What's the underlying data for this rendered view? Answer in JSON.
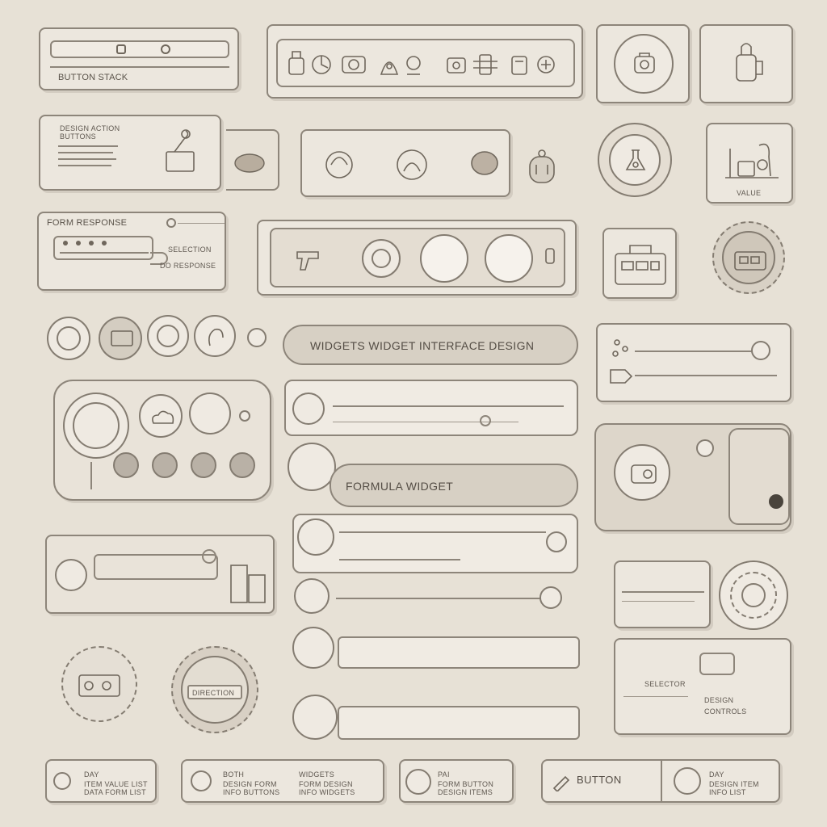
{
  "colors": {
    "background": "#e7e1d6",
    "panel": "#ece7de",
    "stroke": "#8d857a",
    "accent_dark": "#4a443c",
    "pill": "#d7d0c4"
  },
  "top_left_card": {
    "label": "BUTTON STACK"
  },
  "header_card": {
    "title": "DESIGN ACTION",
    "subtitle": "BUTTONS"
  },
  "response_card": {
    "title": "FORM RESPONSE",
    "hint": "SELECTION",
    "footer": "DO RESPONSE"
  },
  "gauge_card": {
    "label": "VALUE"
  },
  "search_pill": {
    "text": "WIDGETS   WIDGET INTERFACE DESIGN"
  },
  "list_item_2": {
    "text": "FORMULA WIDGET"
  },
  "right_card": {
    "label": "SELECTOR",
    "sub_label": "DESIGN",
    "sub_label_2": "CONTROLS"
  },
  "round_badge": {
    "label": "DIRECTION"
  },
  "bottom_cards": [
    {
      "title": "DAY",
      "line1": "ITEM VALUE LIST",
      "line2": "DATA FORM LIST"
    },
    {
      "title": "BOTH",
      "line1": "DESIGN FORM",
      "line2": "INFO BUTTONS"
    },
    {
      "title": "WIDGETS",
      "line1": "FORM DESIGN",
      "line2": "INFO WIDGETS"
    },
    {
      "title": "PAI",
      "line1": "FORM BUTTON",
      "line2": "DESIGN ITEMS"
    },
    {
      "title": "BUTTON",
      "line1": "",
      "line2": ""
    },
    {
      "title": "DAY",
      "line1": "DESIGN ITEM",
      "line2": "INFO LIST"
    }
  ],
  "icons": {
    "top_row": [
      "compass-icon",
      "camera-icon",
      "gear-icon",
      "bottle-icon",
      "robot-icon",
      "tools-icon"
    ],
    "right_badges": [
      "coffee-icon",
      "lamp-icon"
    ]
  }
}
